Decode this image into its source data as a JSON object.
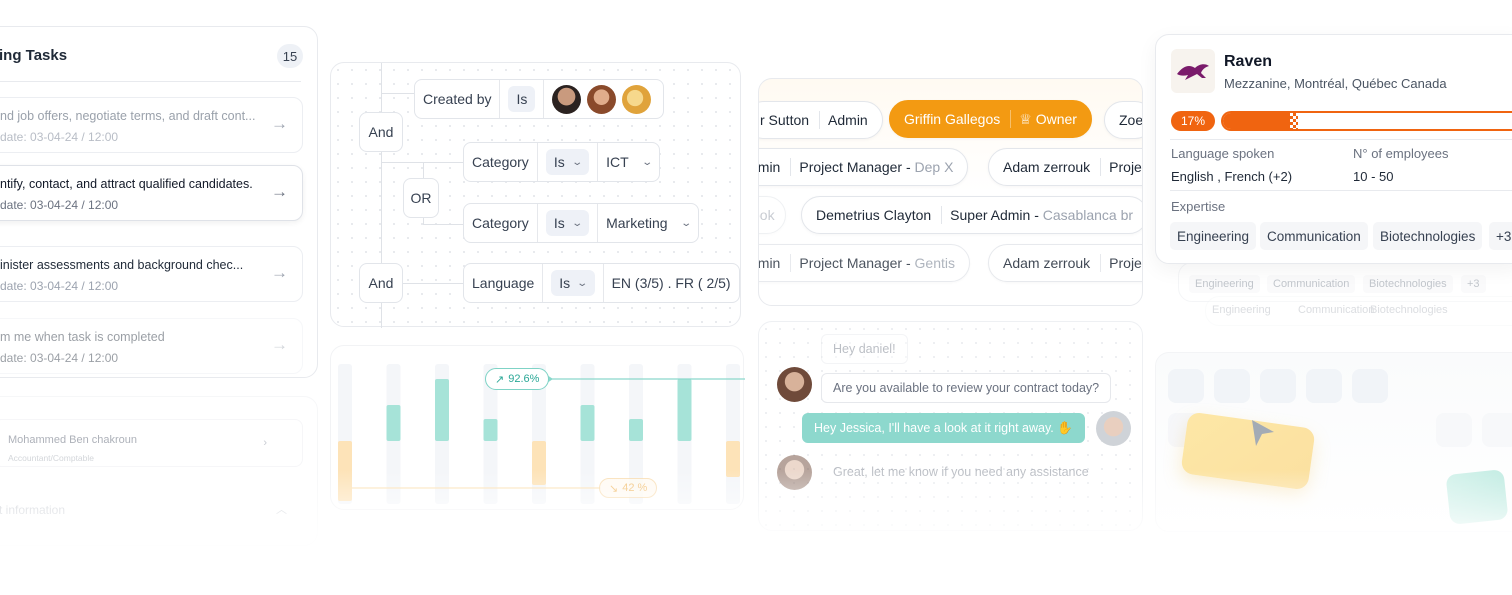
{
  "tasks": {
    "title": "ing Tasks",
    "count": "15",
    "items": [
      {
        "title": "nd job offers, negotiate terms, and draft cont...",
        "date": "date: 03-04-24 / 12:00"
      },
      {
        "title": "ntify, contact, and attract qualified candidates.",
        "date": "date: 03-04-24 / 12:00"
      },
      {
        "title": "inister assessments and background chec...",
        "date": "date: 03-04-24 / 12:00"
      },
      {
        "title": "m me when task is completed",
        "date": "date: 03-04-24 / 12:00"
      }
    ]
  },
  "contact": {
    "name": "Mohammed Ben chakroun",
    "role": "Accountant/Comptable",
    "section": "ct information"
  },
  "filter": {
    "and1": "And",
    "and2": "And",
    "or": "OR",
    "created_by": {
      "field": "Created by",
      "op": "Is"
    },
    "cond1": {
      "field": "Category",
      "op": "Is",
      "value": "ICT"
    },
    "cond2": {
      "field": "Category",
      "op": "Is",
      "value": "Marketing"
    },
    "cond3": {
      "field": "Language",
      "op": "Is",
      "value": "EN (3/5) . FR ( 2/5)"
    }
  },
  "chart_data": {
    "type": "bar",
    "series": [
      {
        "name": "up",
        "values": [
          0,
          36,
          62,
          22,
          0,
          36,
          22,
          62,
          0
        ]
      },
      {
        "name": "down",
        "values": [
          60,
          0,
          0,
          0,
          44,
          0,
          0,
          0,
          36
        ]
      }
    ],
    "annotations": [
      "92.6%",
      "42%"
    ],
    "colors": {
      "up": "#a6e3d8",
      "down": "#fde3b8",
      "track": "#f4f6f9"
    }
  },
  "chart": {
    "badge_up": "92.6%",
    "badge_down": "42 %"
  },
  "members": {
    "rows": [
      [
        {
          "name": "r Sutton",
          "role": "Admin"
        },
        {
          "name": "Griffin Gallegos",
          "role": "Owner",
          "owner": true
        },
        {
          "name": "Zoe",
          "role": ""
        }
      ],
      [
        {
          "name": "amin",
          "role": "Project Manager - ",
          "sub": "Dep X"
        },
        {
          "name": "Adam zerrouk",
          "role": "Projec"
        }
      ],
      [
        {
          "name": "ook",
          "role": ""
        },
        {
          "name": "Demetrius Clayton",
          "role": "Super Admin - ",
          "sub": "Casablanca br"
        }
      ],
      [
        {
          "name": "amin",
          "role": "Project Manager - ",
          "sub": "Gentis"
        },
        {
          "name": "Adam zerrouk",
          "role": "Projec"
        }
      ]
    ]
  },
  "chat": {
    "m1": "Hey daniel!",
    "m2": "Are you available to review your contract today?",
    "m3": "Hey Jessica, I'll have a look at it right away.",
    "m4": "Great, let me know if you need any assistance"
  },
  "company": {
    "name": "Raven",
    "address": "Mezzanine, Montréal, Québec Canada",
    "progress_label": "17%",
    "progress": 0.17,
    "lang_label": "Language spoken",
    "lang_value": "English , French  (+2)",
    "emp_label": "N° of employees",
    "emp_value": "10 - 50",
    "expertise_label": "Expertise",
    "tags": [
      "Engineering",
      "Communication",
      "Biotechnologies",
      "+3"
    ],
    "brand_color": "#f06410",
    "logo_color": "#7a1b6b"
  },
  "ghost_tags": [
    "Engineering",
    "Communication",
    "Biotechnologies",
    "+3"
  ]
}
